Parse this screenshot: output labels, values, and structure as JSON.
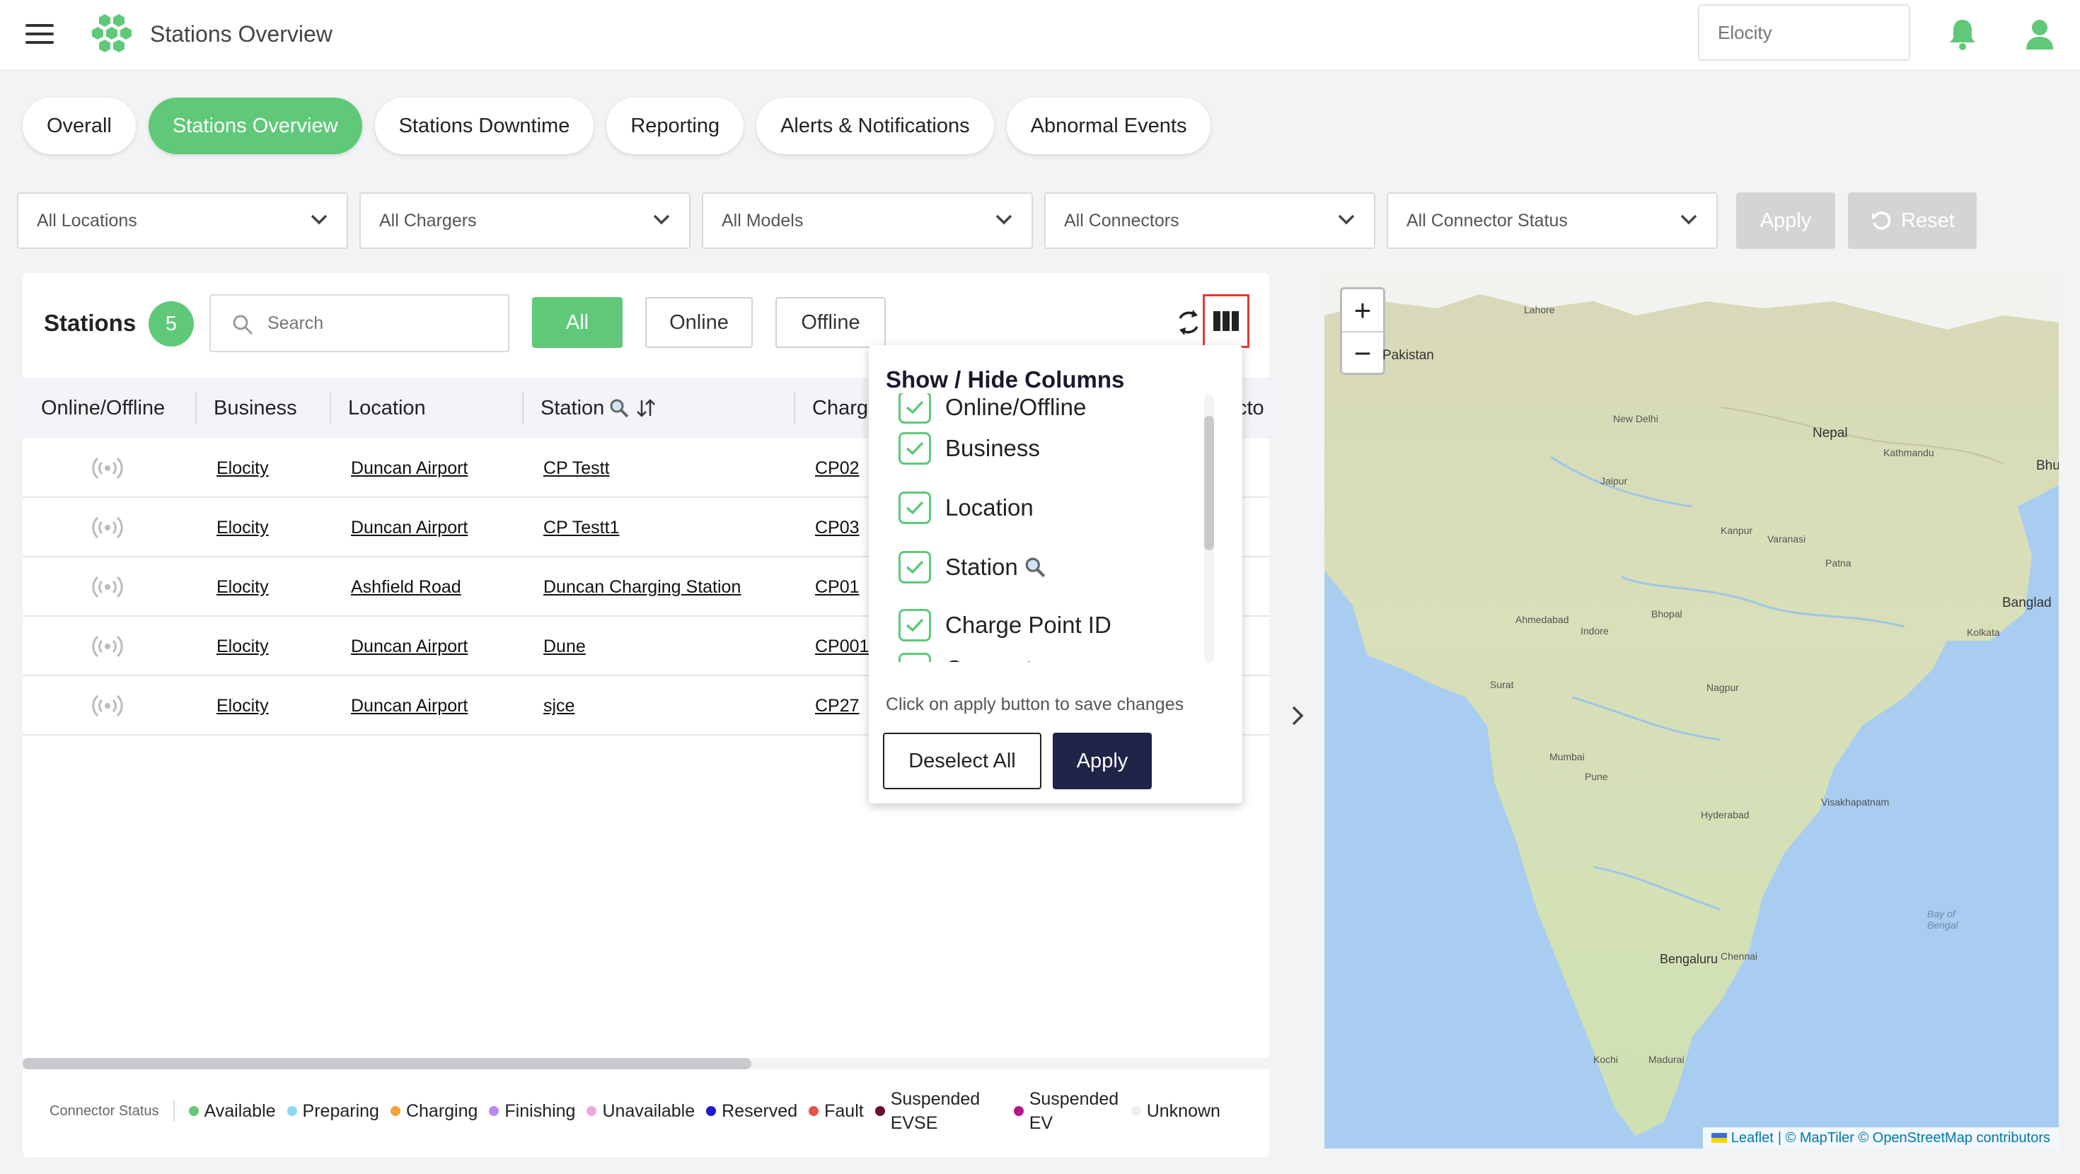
{
  "header": {
    "title": "Stations Overview",
    "org_placeholder": "Elocity"
  },
  "tabs": [
    {
      "label": "Overall"
    },
    {
      "label": "Stations Overview"
    },
    {
      "label": "Stations Downtime"
    },
    {
      "label": "Reporting"
    },
    {
      "label": "Alerts & Notifications"
    },
    {
      "label": "Abnormal Events"
    }
  ],
  "filters": {
    "locations": "All Locations",
    "chargers": "All Chargers",
    "models": "All Models",
    "connectors": "All Connectors",
    "connector_status": "All Connector Status",
    "apply_label": "Apply",
    "reset_label": "Reset"
  },
  "stations": {
    "title": "Stations",
    "count": "5",
    "search_placeholder": "Search",
    "filter_all": "All",
    "filter_online": "Online",
    "filter_offline": "Offline",
    "columns": {
      "online": "Online/Offline",
      "business": "Business",
      "location": "Location",
      "station": "Station",
      "charge": "Charg",
      "connector": "cto"
    },
    "rows": [
      {
        "business": "Elocity",
        "location": "Duncan Airport",
        "station": "CP Testt",
        "cp": "CP02"
      },
      {
        "business": "Elocity",
        "location": "Duncan Airport",
        "station": "CP Testt1",
        "cp": "CP03"
      },
      {
        "business": "Elocity",
        "location": "Ashfield Road",
        "station": "Duncan Charging Station",
        "cp": "CP01"
      },
      {
        "business": "Elocity",
        "location": "Duncan Airport",
        "station": "Dune",
        "cp": "CP001"
      },
      {
        "business": "Elocity",
        "location": "Duncan Airport",
        "station": "sjce",
        "cp": "CP27"
      }
    ]
  },
  "columns_popover": {
    "title": "Show / Hide Columns",
    "items": [
      {
        "label": "Online/Offline"
      },
      {
        "label": "Business"
      },
      {
        "label": "Location"
      },
      {
        "label": "Station"
      },
      {
        "label": "Charge Point ID"
      },
      {
        "label": "Connector"
      }
    ],
    "note": "Click on apply button to save changes",
    "deselect_label": "Deselect All",
    "apply_label": "Apply"
  },
  "legend": {
    "title": "Connector Status",
    "items": [
      {
        "label": "Available",
        "color": "#5fc979"
      },
      {
        "label": "Preparing",
        "color": "#8fd8f5"
      },
      {
        "label": "Charging",
        "color": "#f5a23a"
      },
      {
        "label": "Finishing",
        "color": "#b889f0"
      },
      {
        "label": "Unavailable",
        "color": "#f0a6d8"
      },
      {
        "label": "Reserved",
        "color": "#1a1ad6"
      },
      {
        "label": "Fault",
        "color": "#e5534b"
      },
      {
        "label": "Suspended EVSE",
        "color": "#6b0f2e"
      },
      {
        "label": "Suspended EV",
        "color": "#b5178a"
      },
      {
        "label": "Unknown",
        "color": "#eeeeee"
      }
    ]
  },
  "map": {
    "zoom_in": "+",
    "zoom_out": "−",
    "attribution_leaflet": "Leaflet",
    "attribution_rest": "| © MapTiler © OpenStreetMap contributors",
    "labels": {
      "pakistan": "Pakistan",
      "nepal": "Nepal",
      "bhutan": "Bhu",
      "bangladesh": "Banglad",
      "new_delhi": "New Delhi",
      "kathmandu": "Kathmandu",
      "lahore": "Lahore",
      "jaipur": "Jaipur",
      "ahmedabad": "Ahmedabad",
      "mumbai": "Mumbai",
      "pune": "Pune",
      "hyderabad": "Hyderabad",
      "nagpur": "Nagpur",
      "bhopal": "Bhopal",
      "kanpur": "Kanpur",
      "patna": "Patna",
      "kolkata": "Kolkata",
      "bengaluru": "Bengaluru",
      "chennai": "Chennai",
      "kochi": "Kochi",
      "madurai": "Madurai",
      "visakhapatnam": "Visakhapatnam",
      "bay_of_bengal": "Bay of Bengal",
      "varanasi": "Varanasi",
      "indore": "Indore",
      "surat": "Surat"
    }
  }
}
